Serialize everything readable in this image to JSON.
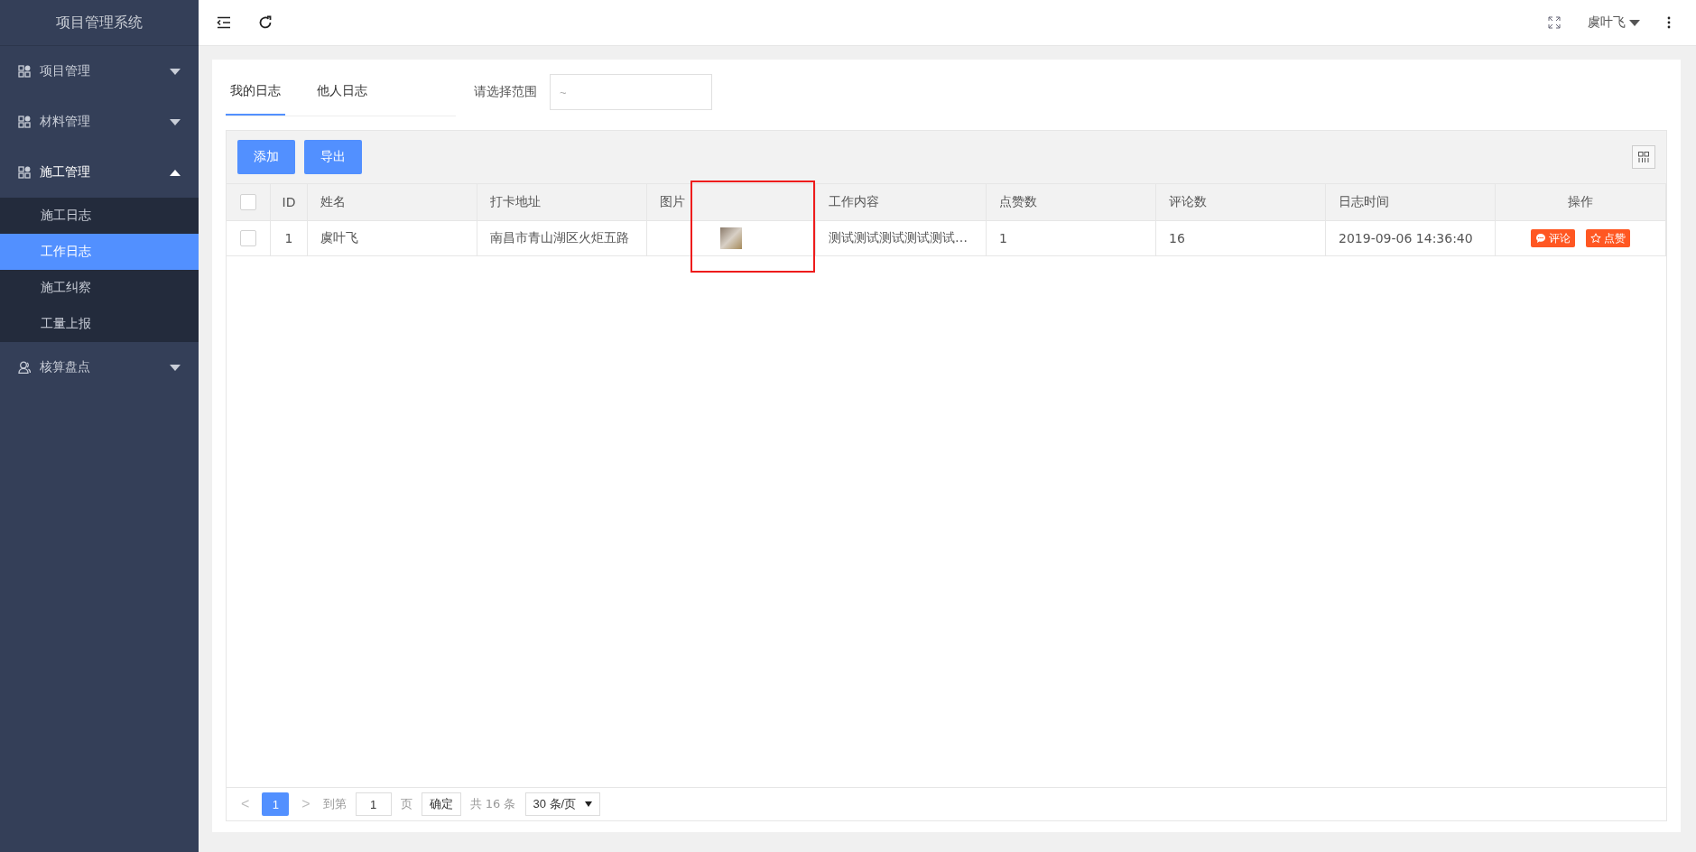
{
  "app_title": "项目管理系统",
  "sidebar": {
    "items": [
      {
        "label": "项目管理",
        "kind": "grid",
        "expanded": false
      },
      {
        "label": "材料管理",
        "kind": "grid",
        "expanded": false
      },
      {
        "label": "施工管理",
        "kind": "grid",
        "expanded": true,
        "children": [
          {
            "label": "施工日志",
            "selected": false
          },
          {
            "label": "工作日志",
            "selected": true
          },
          {
            "label": "施工纠察",
            "selected": false
          },
          {
            "label": "工量上报",
            "selected": false
          }
        ]
      },
      {
        "label": "核算盘点",
        "kind": "user",
        "expanded": false
      }
    ]
  },
  "topbar": {
    "user_name": "虞叶飞"
  },
  "tabs": [
    {
      "label": "我的日志",
      "selected": true
    },
    {
      "label": "他人日志",
      "selected": false
    }
  ],
  "range": {
    "label": "请选择范围",
    "placeholder": "~"
  },
  "toolbar": {
    "buttons": [
      "添加",
      "导出"
    ]
  },
  "table": {
    "header_checked": false,
    "columns": [
      "ID",
      "姓名",
      "打卡地址",
      "图片",
      "工作内容",
      "点赞数",
      "评论数",
      "日志时间",
      "操作"
    ],
    "rows": [
      {
        "checked": false,
        "cells": [
          "1",
          "虞叶飞",
          "南昌市青山湖区火炬五路",
          "",
          "测试测试测试测试测试…",
          "1",
          "16",
          "2019-09-06 14:36:40"
        ],
        "actions": [
          {
            "kind": "comment",
            "label": "评论"
          },
          {
            "kind": "like",
            "label": "点赞"
          }
        ]
      }
    ]
  },
  "pagination": {
    "prev": "<",
    "current": "1",
    "next": ">",
    "goto_label": "到第",
    "goto_value": "1",
    "page_unit": "页",
    "confirm": "确定",
    "total": "共 16 条",
    "page_size": "30 条/页"
  }
}
